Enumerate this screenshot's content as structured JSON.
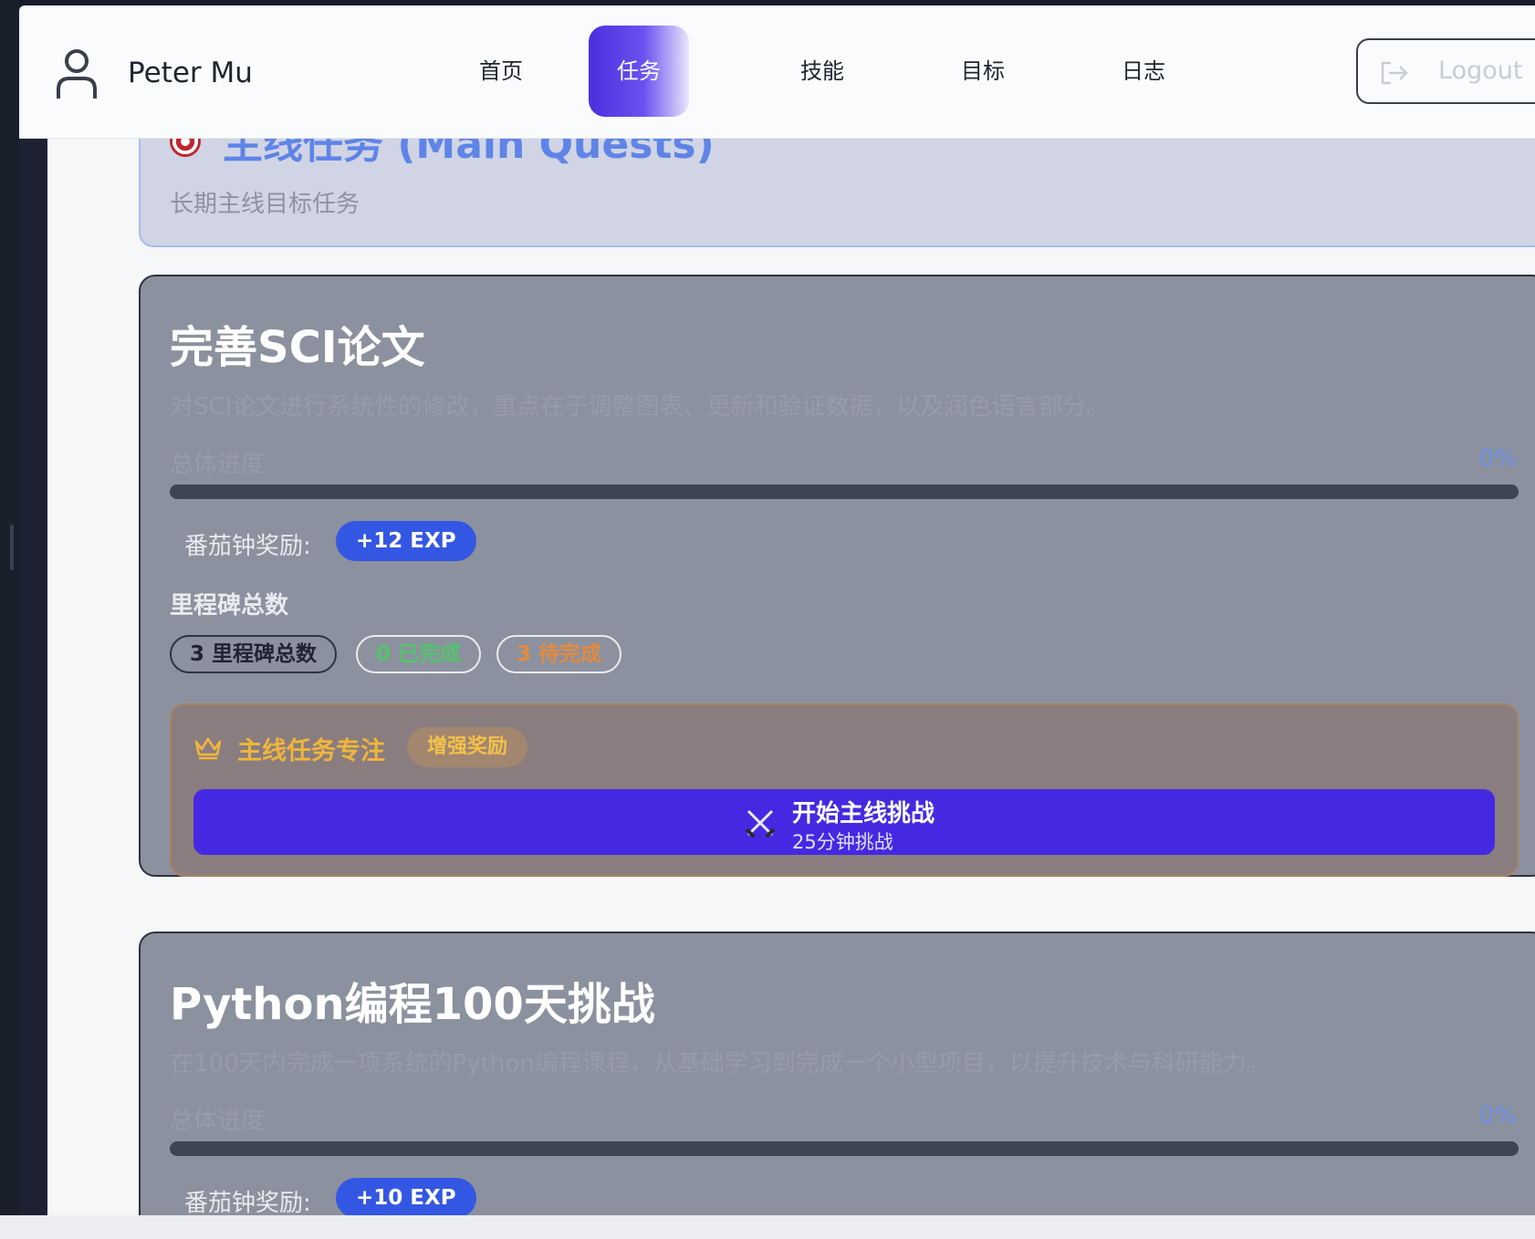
{
  "nav": {
    "user_name": "Peter Mu",
    "items": [
      "首页",
      "任务",
      "技能",
      "目标",
      "日志"
    ],
    "active_item": "任务",
    "logout_label": "Logout"
  },
  "header": {
    "title": "主线任务 (Main Quests)",
    "subtitle": "长期主线目标任务"
  },
  "quests": [
    {
      "title": "完善SCI论文",
      "description": "对SCI论文进行系统性的修改，重点在于调整图表、更新和验证数据，以及润色语言部分。",
      "progress_label": "总体进度",
      "progress_text": "0%",
      "progress_value": 0,
      "pomodoro_label": "番茄钟奖励:",
      "pomodoro_reward": "+12 EXP",
      "milestones_label": "里程碑总数",
      "milestones_total": "3 里程碑总数",
      "milestones_done": "0 已完成",
      "milestones_pending": "3 待完成",
      "focus_label": "主线任务专注",
      "focus_badge": "增强奖励",
      "start_label": "开始主线挑战",
      "start_sub": "25分钟挑战"
    },
    {
      "title": "Python编程100天挑战",
      "description": "在100天内完成一项系统的Python编程课程，从基础学习到完成一个小型项目，以提升技术与科研能力。",
      "progress_label": "总体进度",
      "progress_text": "0%",
      "progress_value": 0,
      "pomodoro_label": "番茄钟奖励:",
      "pomodoro_reward": "+10 EXP"
    }
  ],
  "colors": {
    "accent": "#4529e2",
    "badge_blue": "#3457e3",
    "card_bg": "#8b919e",
    "done_green": "#52c46a",
    "pending_orange": "#e78a3c",
    "crown_gold": "#f0b63a"
  },
  "icons": [
    "user-icon",
    "logout-icon",
    "target-icon",
    "crown-icon",
    "crossed-swords-icon"
  ]
}
